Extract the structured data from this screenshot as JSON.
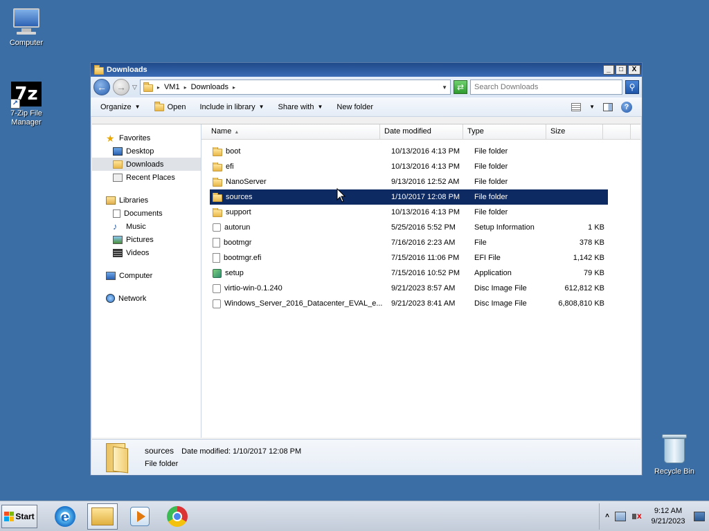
{
  "desktop": {
    "icons": [
      {
        "label": "Computer",
        "icon": "computer-icon"
      },
      {
        "label": "7-Zip File Manager",
        "icon": "7zip-icon",
        "glyph": "7z"
      },
      {
        "label": "Recycle Bin",
        "icon": "recycle-bin-icon"
      }
    ]
  },
  "window": {
    "title": "Downloads",
    "controls": {
      "minimize": "_",
      "maximize": "□",
      "close": "X"
    },
    "address": {
      "crumbs": [
        "VM1",
        "Downloads"
      ]
    },
    "search": {
      "placeholder": "Search Downloads"
    },
    "toolbar": {
      "organize": "Organize",
      "open": "Open",
      "include_in_library": "Include in library",
      "share_with": "Share with",
      "new_folder": "New folder"
    },
    "nav": {
      "favorites": {
        "label": "Favorites",
        "items": [
          "Desktop",
          "Downloads",
          "Recent Places"
        ],
        "selected": "Downloads"
      },
      "libraries": {
        "label": "Libraries",
        "items": [
          "Documents",
          "Music",
          "Pictures",
          "Videos"
        ]
      },
      "computer": "Computer",
      "network": "Network"
    },
    "columns": {
      "name": "Name",
      "date": "Date modified",
      "type": "Type",
      "size": "Size"
    },
    "files": [
      {
        "name": "boot",
        "date": "10/13/2016 4:13 PM",
        "type": "File folder",
        "size": "",
        "icon": "folder-icon"
      },
      {
        "name": "efi",
        "date": "10/13/2016 4:13 PM",
        "type": "File folder",
        "size": "",
        "icon": "folder-icon"
      },
      {
        "name": "NanoServer",
        "date": "9/13/2016 12:52 AM",
        "type": "File folder",
        "size": "",
        "icon": "folder-icon"
      },
      {
        "name": "sources",
        "date": "1/10/2017 12:08 PM",
        "type": "File folder",
        "size": "",
        "icon": "folder-icon",
        "selected": true
      },
      {
        "name": "support",
        "date": "10/13/2016 4:13 PM",
        "type": "File folder",
        "size": "",
        "icon": "folder-icon"
      },
      {
        "name": "autorun",
        "date": "5/25/2016 5:52 PM",
        "type": "Setup Information",
        "size": "1 KB",
        "icon": "setup-info-icon"
      },
      {
        "name": "bootmgr",
        "date": "7/16/2016 2:23 AM",
        "type": "File",
        "size": "378 KB",
        "icon": "file-icon"
      },
      {
        "name": "bootmgr.efi",
        "date": "7/15/2016 11:06 PM",
        "type": "EFI File",
        "size": "1,142 KB",
        "icon": "file-icon"
      },
      {
        "name": "setup",
        "date": "7/15/2016 10:52 PM",
        "type": "Application",
        "size": "79 KB",
        "icon": "application-icon"
      },
      {
        "name": "virtio-win-0.1.240",
        "date": "9/21/2023 8:57 AM",
        "type": "Disc Image File",
        "size": "612,812 KB",
        "icon": "disc-image-icon"
      },
      {
        "name": "Windows_Server_2016_Datacenter_EVAL_e...",
        "date": "9/21/2023 8:41 AM",
        "type": "Disc Image File",
        "size": "6,808,810 KB",
        "icon": "disc-image-icon"
      }
    ],
    "details": {
      "name": "sources",
      "date_label": "Date modified:",
      "date_value": "1/10/2017 12:08 PM",
      "type": "File folder"
    }
  },
  "taskbar": {
    "start_label": "Start",
    "apps": [
      "internet-explorer-icon",
      "windows-explorer-icon",
      "media-player-icon",
      "chrome-icon"
    ],
    "clock": {
      "time": "9:12 AM",
      "date": "9/21/2023"
    },
    "tray_overflow": "˄"
  }
}
